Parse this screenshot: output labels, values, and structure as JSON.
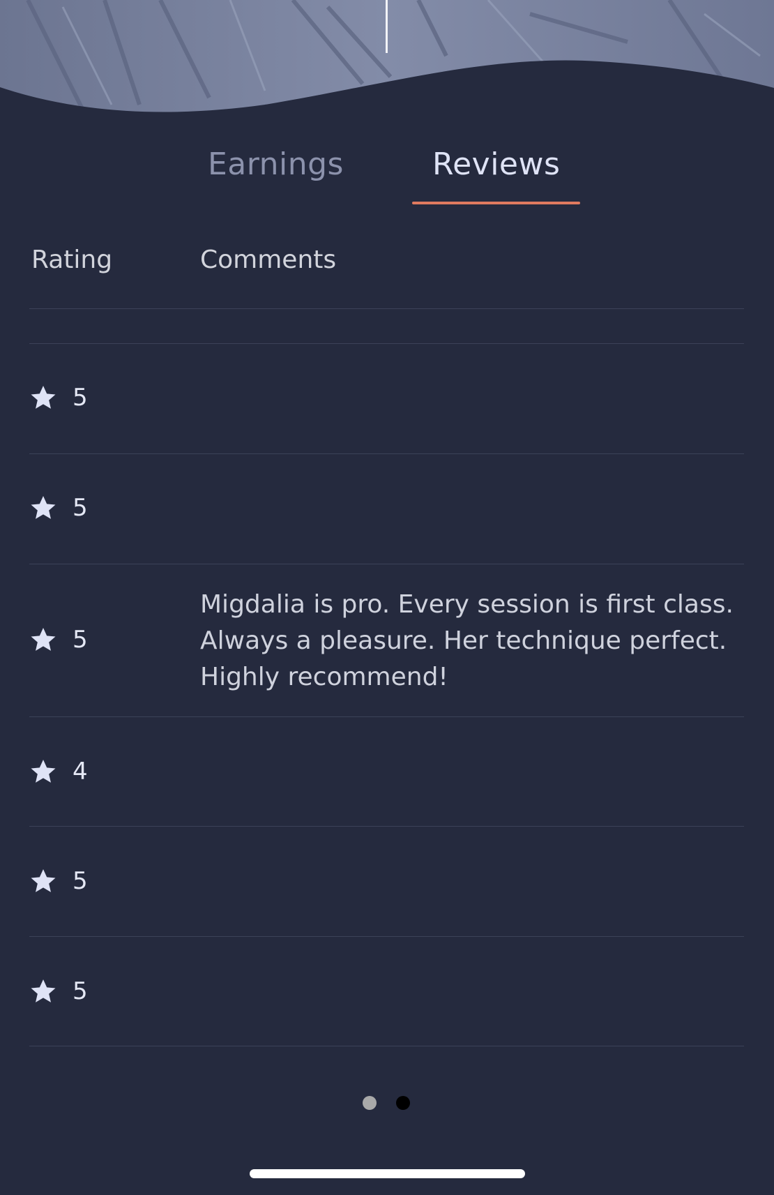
{
  "colors": {
    "background": "#252a3e",
    "accent": "#e07a5f",
    "star": "#dfe3f6",
    "header_photo": "#7d86a3"
  },
  "tabs": [
    {
      "label": "Earnings",
      "selected": false
    },
    {
      "label": "Reviews",
      "selected": true
    }
  ],
  "table": {
    "headers": {
      "rating": "Rating",
      "comments": "Comments"
    },
    "rows": [
      {
        "rating": "5",
        "comment": ""
      },
      {
        "rating": "5",
        "comment": ""
      },
      {
        "rating": "5",
        "comment": "Migdalia is pro.  Every session is first class. Always a pleasure. Her technique perfect. Highly recommend!"
      },
      {
        "rating": "4",
        "comment": ""
      },
      {
        "rating": "5",
        "comment": ""
      },
      {
        "rating": "5",
        "comment": ""
      }
    ]
  },
  "pager": {
    "page_count": 2,
    "current_page": 2
  },
  "icons": {
    "rating": "star-icon"
  }
}
